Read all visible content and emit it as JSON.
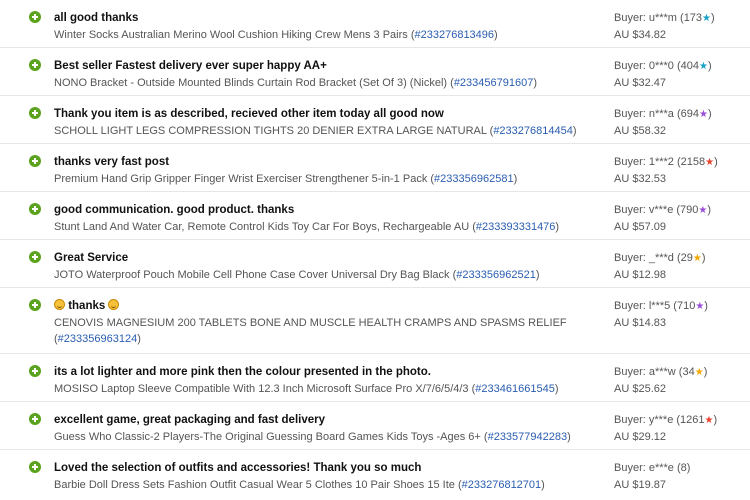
{
  "feedback": [
    {
      "comment": "all good thanks",
      "item_text": "Winter Socks Australian Merino Wool Cushion Hiking Crew Mens 3 Pairs",
      "item_number": "#233276813496",
      "buyer_label": "Buyer: u***m (173",
      "star_color": "teal",
      "price": "AU $34.82"
    },
    {
      "comment": "Best seller Fastest delivery ever super happy AA+",
      "item_text": "NONO Bracket - Outside Mounted Blinds Curtain Rod Bracket (Set Of 3) (Nickel)",
      "item_number": "#233456791607",
      "buyer_label": "Buyer: 0***0 (404",
      "star_color": "teal",
      "price": "AU $32.47"
    },
    {
      "comment": "Thank you item is as described, recieved other item today all good now",
      "item_text": "SCHOLL LIGHT LEGS COMPRESSION TIGHTS 20 DENIER EXTRA LARGE NATURAL",
      "item_number": "#233276814454",
      "buyer_label": "Buyer: n***a (694",
      "star_color": "purple",
      "price": "AU $58.32"
    },
    {
      "comment": "thanks very fast post",
      "item_text": "Premium Hand Grip Gripper Finger Wrist Exerciser Strengthener 5-in-1 Pack",
      "item_number": "#233356962581",
      "buyer_label": "Buyer: 1***2 (2158",
      "star_color": "red",
      "price": "AU $32.53"
    },
    {
      "comment": "good communication. good product. thanks",
      "item_text": "Stunt Land And Water Car, Remote Control Kids Toy Car For Boys, Rechargeable AU",
      "item_number": "#233393331476",
      "buyer_label": "Buyer: v***e (790",
      "star_color": "purple",
      "price": "AU $57.09"
    },
    {
      "comment": "Great Service",
      "item_text": "JOTO Waterproof Pouch Mobile Cell Phone Case Cover Universal Dry Bag Black",
      "item_number": "#233356962521",
      "buyer_label": "Buyer: _***d (29",
      "star_color": "yellow",
      "price": "AU $12.98"
    },
    {
      "comment": "thanks",
      "item_text": "CENOVIS MAGNESIUM 200 TABLETS BONE AND MUSCLE HEALTH CRAMPS AND SPASMS RELIEF",
      "item_number": "#233356963124",
      "buyer_label": "Buyer: l***5 (710",
      "star_color": "purple",
      "price": "AU $14.83"
    },
    {
      "comment": "its a lot lighter and more pink then the colour presented in the photo.",
      "item_text": "MOSISO Laptop Sleeve Compatible With 12.3 Inch Microsoft Surface Pro X/7/6/5/4/3",
      "item_number": "#233461661545",
      "buyer_label": "Buyer: a***w (34",
      "star_color": "yellow",
      "price": "AU $25.62"
    },
    {
      "comment": "excellent game, great packaging and fast delivery",
      "item_text": "Guess Who Classic-2 Players-The Original Guessing Board Games Kids Toys -Ages 6+",
      "item_number": "#233577942283",
      "buyer_label": "Buyer: y***e (1261",
      "star_color": "red",
      "price": "AU $29.12"
    },
    {
      "comment": "Loved the selection of outfits and accessories! Thank you so much",
      "item_text": "Barbie Doll Dress Sets Fashion Outfit Casual Wear 5 Clothes 10 Pair Shoes 15 Ite",
      "item_number": "#233276812701",
      "buyer_label": "Buyer: e***e (8)",
      "star_color": "",
      "price": "AU $19.87"
    }
  ],
  "star_glyph": "★",
  "close_paren": ")",
  "open_paren": " (",
  "close_paren_only": ")",
  "colors": {
    "positive_icon": "#5ba31f",
    "link": "#2a5db0",
    "star_teal": "#17a2c7",
    "star_purple": "#9b4fd6",
    "star_red": "#e8432e",
    "star_yellow": "#f5a800"
  }
}
